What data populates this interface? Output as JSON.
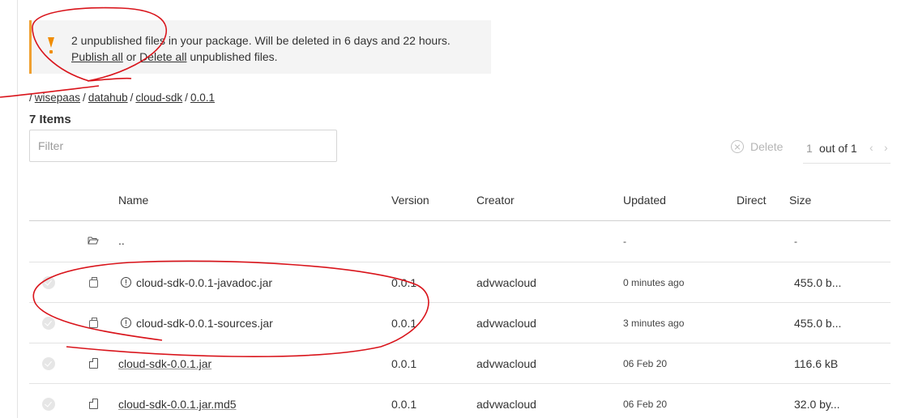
{
  "banner": {
    "line1": "2 unpublished files in your package. Will be deleted in 6 days and 22 hours.",
    "publish_all": "Publish all",
    "or": "or",
    "delete_all": "Delete all",
    "tail": "unpublished files."
  },
  "breadcrumb": {
    "separator": "/",
    "items": [
      "wisepaas",
      "datahub",
      "cloud-sdk",
      "0.0.1"
    ]
  },
  "items_count": "7 Items",
  "filter": {
    "placeholder": "Filter",
    "value": ""
  },
  "toolbar": {
    "delete_label": "Delete"
  },
  "pagination": {
    "current": "1",
    "of_text": "out of 1",
    "prev": "‹",
    "next": "›"
  },
  "table": {
    "columns": {
      "name": "Name",
      "version": "Version",
      "creator": "Creator",
      "updated": "Updated",
      "direct": "Direct",
      "size": "Size"
    },
    "parent_row": {
      "name": "..",
      "updated": "-",
      "size": "-"
    },
    "rows": [
      {
        "name": "cloud-sdk-0.0.1-javadoc.jar",
        "version": "0.0.1",
        "creator": "advwacloud",
        "updated": "0 minutes ago",
        "size": "455.0 b...",
        "unpublished": true
      },
      {
        "name": "cloud-sdk-0.0.1-sources.jar",
        "version": "0.0.1",
        "creator": "advwacloud",
        "updated": "3 minutes ago",
        "size": "455.0 b...",
        "unpublished": true
      },
      {
        "name": "cloud-sdk-0.0.1.jar",
        "version": "0.0.1",
        "creator": "advwacloud",
        "updated": "06 Feb 20",
        "size": "116.6 kB",
        "unpublished": false
      },
      {
        "name": "cloud-sdk-0.0.1.jar.md5",
        "version": "0.0.1",
        "creator": "advwacloud",
        "updated": "06 Feb 20",
        "size": "32.0 by...",
        "unpublished": false
      }
    ]
  },
  "colors": {
    "warning": "#f08c00",
    "annotation": "#d9141b",
    "accent_border": "#f0a030"
  }
}
